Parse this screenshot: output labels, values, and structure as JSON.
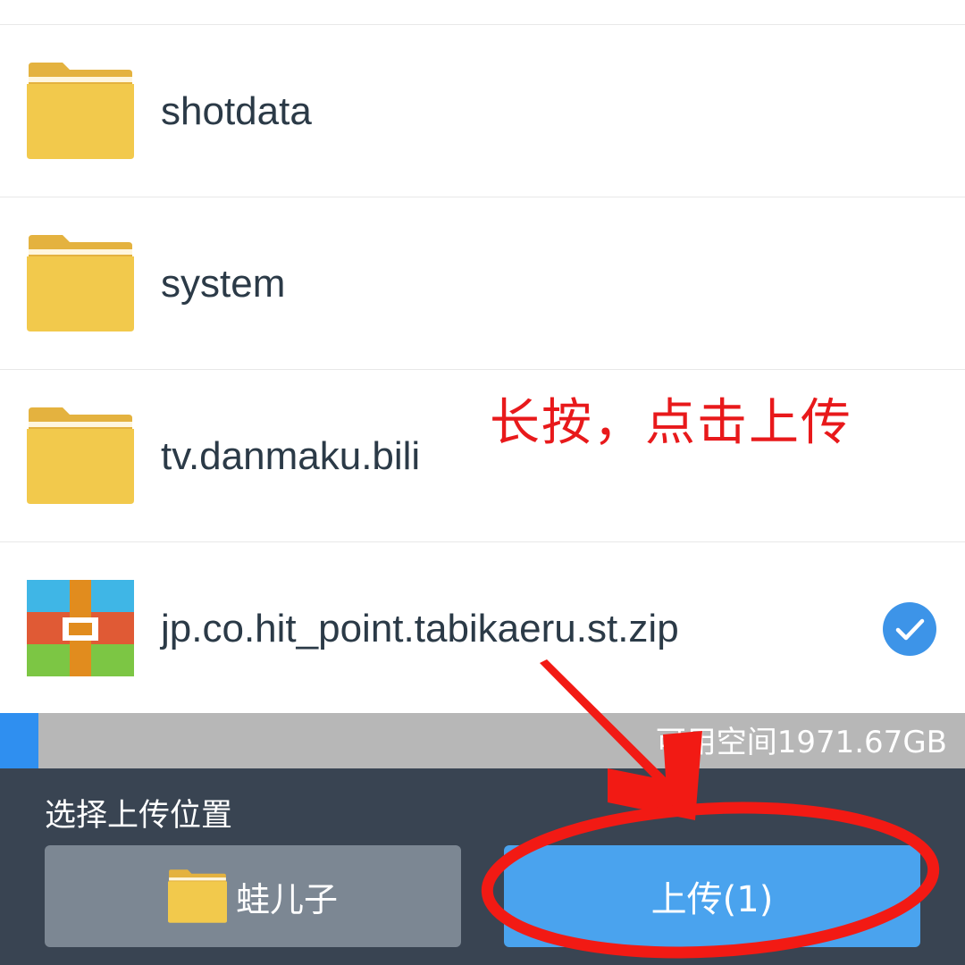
{
  "files": [
    {
      "name": "shotdata",
      "type": "folder"
    },
    {
      "name": "system",
      "type": "folder"
    },
    {
      "name": "tv.danmaku.bili",
      "type": "folder"
    },
    {
      "name": "jp.co.hit_point.tabikaeru.st.zip",
      "type": "zip",
      "selected": true
    }
  ],
  "annotation": {
    "text": "长按，点击上传",
    "color": "#e8191b"
  },
  "storage": {
    "label": "可用空间1971.67GB",
    "used_fraction": 0.04
  },
  "upload_panel": {
    "title": "选择上传位置",
    "location_label": "蛙儿子",
    "upload_label": "上传(1)"
  },
  "colors": {
    "folder": "#f2c94c",
    "accent_blue": "#4aa3ee",
    "panel_bg": "#394452"
  },
  "icons": {
    "folder": "folder-icon",
    "zip": "zip-archive-icon",
    "check": "checkmark-circle-icon"
  }
}
